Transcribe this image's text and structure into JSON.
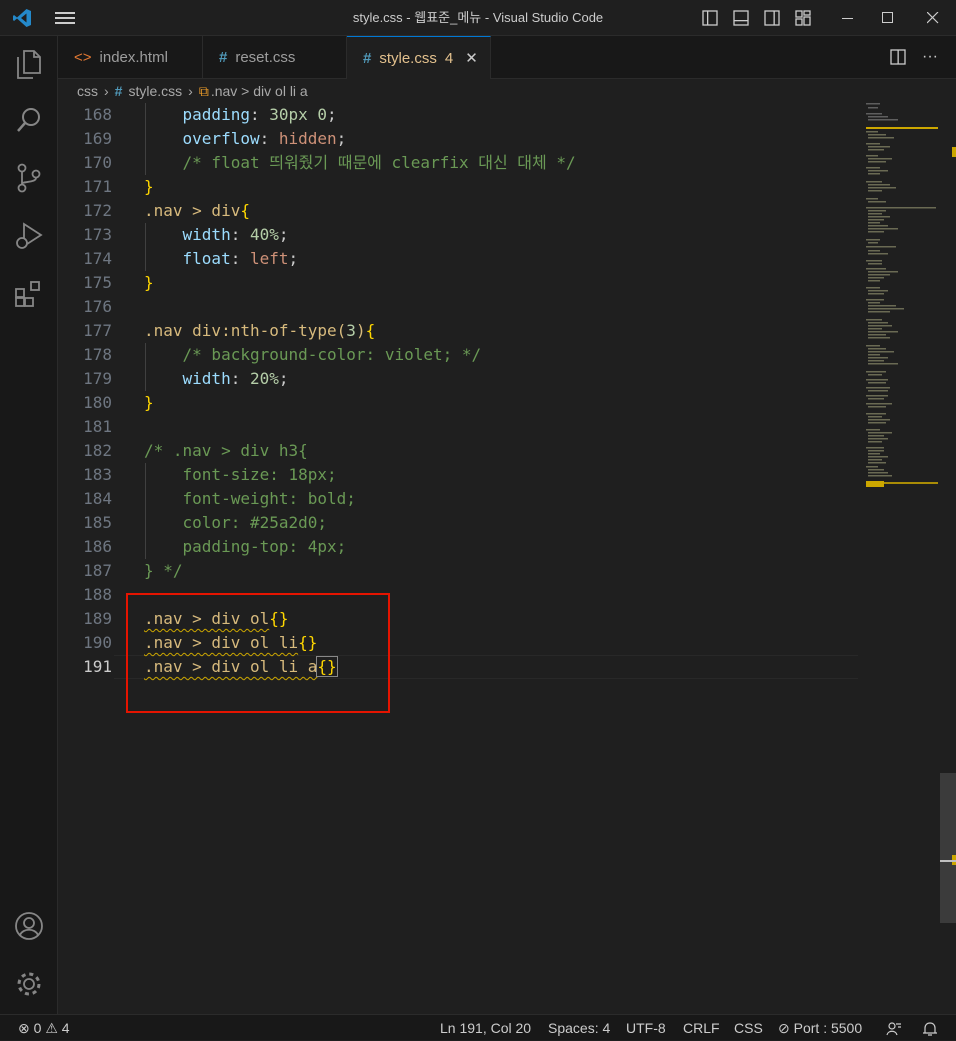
{
  "window": {
    "title": "style.css - 웹표준_메뉴 - Visual Studio Code"
  },
  "tabs": [
    {
      "label": "index.html",
      "icon": "html-file-icon"
    },
    {
      "label": "reset.css",
      "icon": "css-file-icon"
    },
    {
      "label": "style.css",
      "badge": "4",
      "icon": "css-file-icon",
      "active": true
    }
  ],
  "breadcrumb": {
    "folder": "css",
    "file": "style.css",
    "symbol": ".nav > div ol li a"
  },
  "editor": {
    "current_line": "191",
    "lines": [
      {
        "n": "168",
        "t": "    padding: 30px 0;"
      },
      {
        "n": "169",
        "t": "    overflow: hidden;"
      },
      {
        "n": "170",
        "t": "    /* float 띄워줬기 때문에 clearfix 대신 대체 */"
      },
      {
        "n": "171",
        "t": "}"
      },
      {
        "n": "172",
        "t": ".nav > div{"
      },
      {
        "n": "173",
        "t": "    width: 40%;"
      },
      {
        "n": "174",
        "t": "    float: left;"
      },
      {
        "n": "175",
        "t": "}"
      },
      {
        "n": "176",
        "t": ""
      },
      {
        "n": "177",
        "t": ".nav div:nth-of-type(3){"
      },
      {
        "n": "178",
        "t": "    /* background-color: violet; */"
      },
      {
        "n": "179",
        "t": "    width: 20%;"
      },
      {
        "n": "180",
        "t": "}"
      },
      {
        "n": "181",
        "t": ""
      },
      {
        "n": "182",
        "t": "/* .nav > div h3{"
      },
      {
        "n": "183",
        "t": "    font-size: 18px;"
      },
      {
        "n": "184",
        "t": "    font-weight: bold;"
      },
      {
        "n": "185",
        "t": "    color: #25a2d0;"
      },
      {
        "n": "186",
        "t": "    padding-top: 4px;"
      },
      {
        "n": "187",
        "t": "} */"
      },
      {
        "n": "188",
        "t": ""
      },
      {
        "n": "189",
        "t": ".nav > div ol{}"
      },
      {
        "n": "190",
        "t": ".nav > div ol li{}"
      },
      {
        "n": "191",
        "t": ".nav > div ol li a{}"
      }
    ]
  },
  "statusbar": {
    "errors": "0",
    "warnings": "4",
    "position": "Ln 191, Col 20",
    "spaces": "Spaces: 4",
    "encoding": "UTF-8",
    "eol": "CRLF",
    "language": "CSS",
    "port": "Port : 5500"
  },
  "colors": {
    "accent": "#0078d4",
    "selector": "#d7ba7d",
    "property": "#9cdcfe",
    "number": "#b5cea8",
    "value": "#ce9178",
    "comment": "#6a9955",
    "bracket": "#ffd700",
    "highlight_box": "#e51400",
    "warning": "#cca700"
  }
}
